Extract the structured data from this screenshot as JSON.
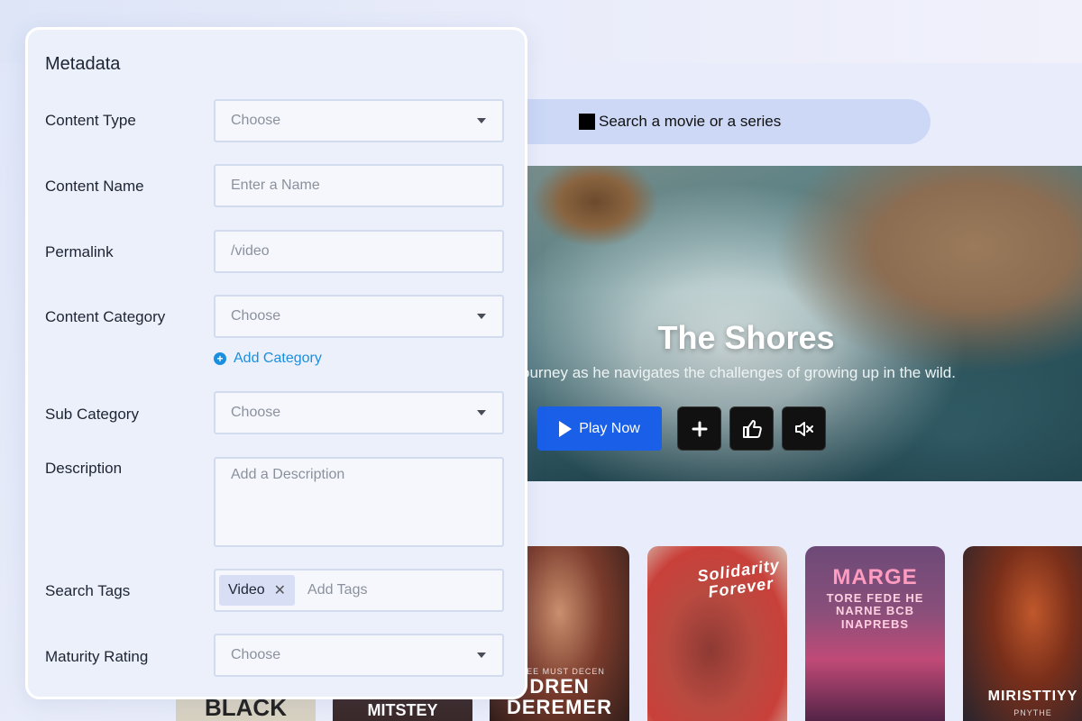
{
  "search": {
    "placeholder": "Search a movie or a series"
  },
  "hero": {
    "title": "The Shores",
    "description": "ourney as he navigates the challenges of growing up in the wild.",
    "play_label": "Play Now",
    "buttons": [
      "plus-icon",
      "thumbs-up-icon",
      "mute-icon"
    ]
  },
  "posters": [
    {
      "title": "DREN\nDEREMER",
      "subtitle": "TREE MUST DECEN"
    },
    {
      "title": "Solidarity Forever",
      "subtitle": ""
    },
    {
      "title": "MARGE",
      "subtitle": "TORE FEDE HE NARNE BCB INAPREBS"
    },
    {
      "title": "MIRISTTIYY",
      "subtitle": "PNYTHE"
    }
  ],
  "bottom_posters": [
    {
      "title": "BLACK"
    },
    {
      "title": "MITSTEY"
    }
  ],
  "metadata": {
    "title": "Metadata",
    "fields": [
      {
        "label": "Content Type",
        "value": "Choose",
        "kind": "select"
      },
      {
        "label": "Content Name",
        "value": "Enter a Name",
        "kind": "input"
      },
      {
        "label": "Permalink",
        "value": "/video",
        "kind": "input"
      },
      {
        "label": "Content Category",
        "value": "Choose",
        "kind": "select"
      },
      {
        "label": "Sub Category",
        "value": "Choose",
        "kind": "select"
      },
      {
        "label": "Description",
        "value": "Add a Description",
        "kind": "textarea"
      },
      {
        "label": "Search Tags",
        "value": "Add Tags",
        "kind": "tags"
      },
      {
        "label": "Maturity Rating",
        "value": "Choose",
        "kind": "select"
      }
    ],
    "add_category_label": "Add Category",
    "tags": [
      "Video"
    ]
  },
  "colors": {
    "accent": "#1a5fe8",
    "link": "#1a8fe0",
    "panel_bg": "#ecf0fb"
  }
}
